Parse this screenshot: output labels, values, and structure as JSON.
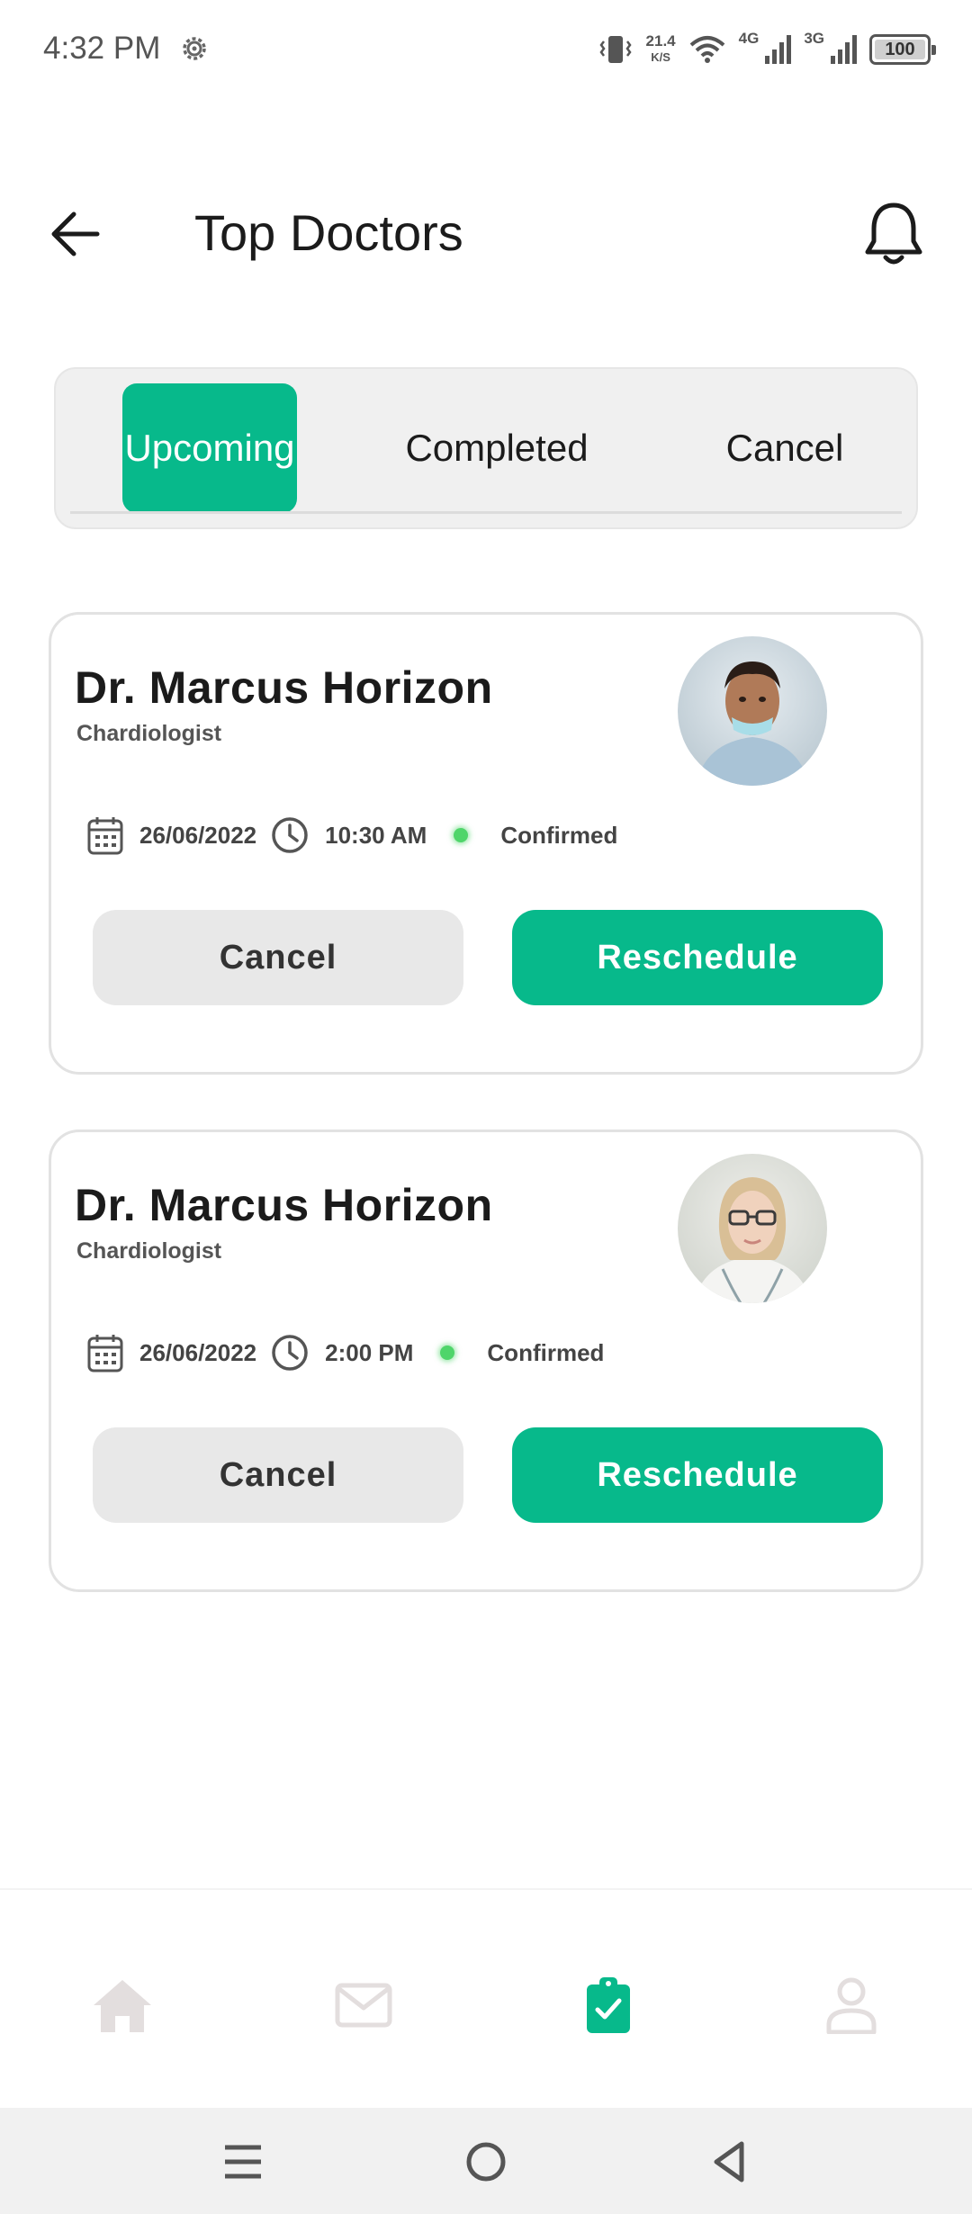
{
  "status_bar": {
    "time": "4:32 PM",
    "speed_value": "21.4",
    "speed_unit": "K/S",
    "network_1": "4G",
    "network_2": "3G",
    "battery": "100"
  },
  "header": {
    "title": "Top Doctors",
    "back_icon": "arrow-left-icon",
    "notification_icon": "bell-icon"
  },
  "tabs": [
    {
      "label": "Upcoming",
      "active": true
    },
    {
      "label": "Completed",
      "active": false
    },
    {
      "label": "Cancel",
      "active": false
    }
  ],
  "appointments": [
    {
      "doctor_name": "Dr. Marcus Horizon",
      "specialty": "Chardiologist",
      "date": "26/06/2022",
      "time": "10:30 AM",
      "status": "Confirmed",
      "cancel_label": "Cancel",
      "reschedule_label": "Reschedule"
    },
    {
      "doctor_name": "Dr. Marcus Horizon",
      "specialty": "Chardiologist",
      "date": "26/06/2022",
      "time": "2:00 PM",
      "status": "Confirmed",
      "cancel_label": "Cancel",
      "reschedule_label": "Reschedule"
    }
  ],
  "bottom_nav": [
    {
      "icon": "home-icon",
      "active": false
    },
    {
      "icon": "mail-icon",
      "active": false
    },
    {
      "icon": "clipboard-check-icon",
      "active": true
    },
    {
      "icon": "user-icon",
      "active": false
    }
  ],
  "colors": {
    "accent": "#07b98b",
    "status_confirmed": "#4fd56a",
    "inactive_icon": "#e3dede"
  }
}
